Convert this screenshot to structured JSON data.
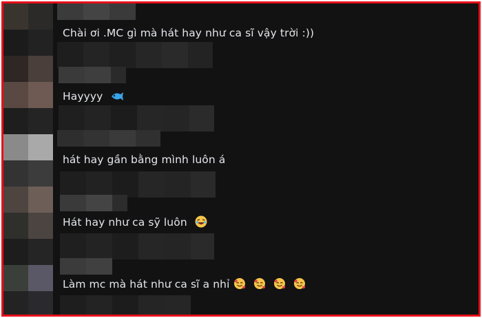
{
  "comments": [
    {
      "text": "Chài ơi .MC gì mà hát hay như ca sĩ vậy trời :))",
      "emojis": []
    },
    {
      "text": "Hayyyy",
      "emojis": [
        "fish-icon"
      ]
    },
    {
      "text": "hát hay gần bằng mình luôn á",
      "emojis": []
    },
    {
      "text": "Hát hay như ca sỹ luôn",
      "emojis": [
        "laughing-face-icon"
      ]
    },
    {
      "text": "Làm mc mà hát như ca sĩ a nhỉ",
      "emojis": [
        "smiling-face-with-hearts-icon",
        "smiling-face-with-hearts-icon",
        "smiling-face-with-hearts-icon",
        "smiling-face-with-hearts-icon"
      ]
    }
  ],
  "colors": {
    "frame_border": "#e8101a",
    "background": "#121212",
    "text": "#e4e6eb",
    "fish": "#3aa4e8",
    "emoji_face": "#f6c44a",
    "heart": "#e8364e"
  }
}
